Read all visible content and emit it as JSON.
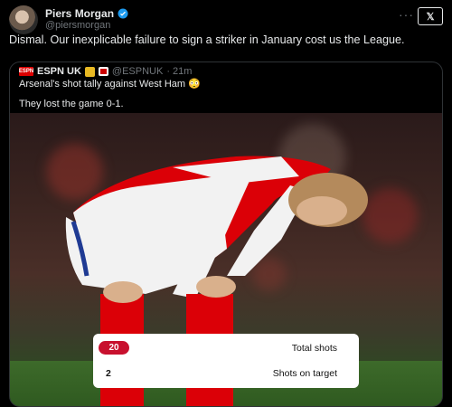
{
  "tweet": {
    "author_name": "Piers Morgan",
    "author_handle": "@piersmorgan",
    "text": "Dismal. Our inexplicable failure to sign a striker in January cost us the League."
  },
  "quote": {
    "author_name": "ESPN UK",
    "author_handle": "@ESPNUK",
    "time": "· 21m",
    "logo_text": "ESPN",
    "line1": "Arsenal's shot tally against West Ham 😳",
    "line2": "They lost the game 0-1."
  },
  "stats": [
    {
      "value": "20",
      "label": "Total shots"
    },
    {
      "value": "2",
      "label": "Shots on target"
    }
  ],
  "icons": {
    "x_logo": "x-logo-icon",
    "more": "more-icon"
  },
  "colors": {
    "background": "#000000",
    "verified": "#1d9bf0",
    "espn": "#dd0000",
    "arsenal_red": "#c8102e"
  }
}
